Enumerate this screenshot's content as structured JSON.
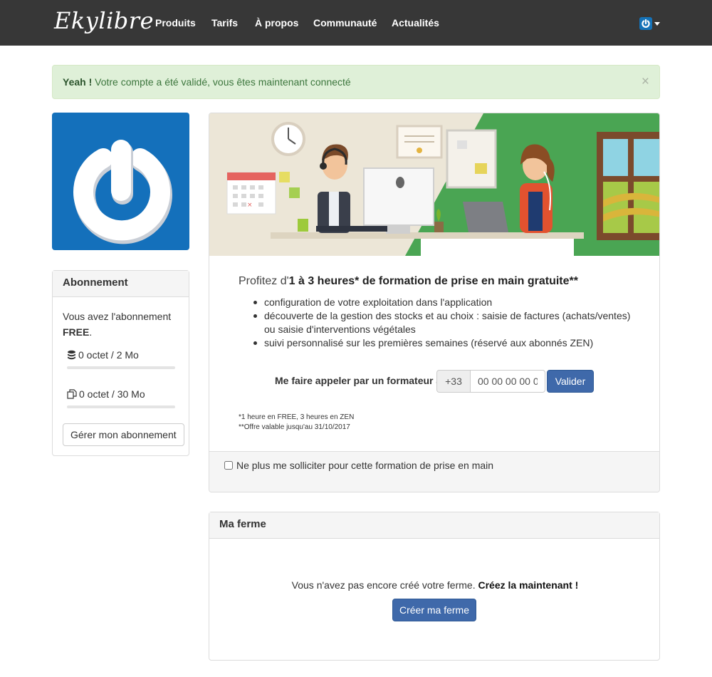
{
  "navbar": {
    "logo": "Ekylibre",
    "links": [
      "Produits",
      "Tarifs",
      "À propos",
      "Communauté",
      "Actualités"
    ]
  },
  "alert": {
    "strong": "Yeah !",
    "message": "Votre compte a été validé, vous êtes maintenant connecté",
    "close": "×"
  },
  "subscription": {
    "heading": "Abonnement",
    "text_prefix": "Vous avez l'abonnement",
    "plan": "FREE",
    "text_suffix": ".",
    "storage": {
      "label": "0 octet / 2 Mo",
      "fraction": 0
    },
    "documents": {
      "label": "0 octet / 30 Mo",
      "fraction": 0
    },
    "manage_button": "Gérer mon abonnement"
  },
  "training": {
    "title_prefix": "Profitez d'",
    "title_strong": "1 à 3 heures* de formation de prise en main gratuite**",
    "bullets": [
      "configuration de votre exploitation dans l'application",
      "découverte de la gestion des stocks et au choix : saisie de factures (achats/ventes) ou saisie d'interventions végétales",
      "suivi personnalisé sur les premières semaines (réservé aux abonnés ZEN)"
    ],
    "call_label": "Me faire appeler par un formateur au",
    "phone_prefix": "+33",
    "phone_value": "00 00 00 00 0",
    "submit": "Valider",
    "note1": "*1 heure en FREE, 3 heures en ZEN",
    "note2": "**Offre valable jusqu'au 31/10/2017",
    "optout_label": "Ne plus me solliciter pour cette formation de prise en main"
  },
  "farm": {
    "heading": "Ma ferme",
    "text": "Vous n'avez pas encore créé votre ferme.",
    "text_strong": "Créez la maintenant !",
    "button": "Créer ma ferme"
  },
  "colors": {
    "navbar": "#373737",
    "brand_blue": "#1470bb",
    "primary": "#3f69aa",
    "alert_bg": "#dff0d8",
    "alert_text": "#3c763d",
    "illustration_green": "#4aa553"
  }
}
